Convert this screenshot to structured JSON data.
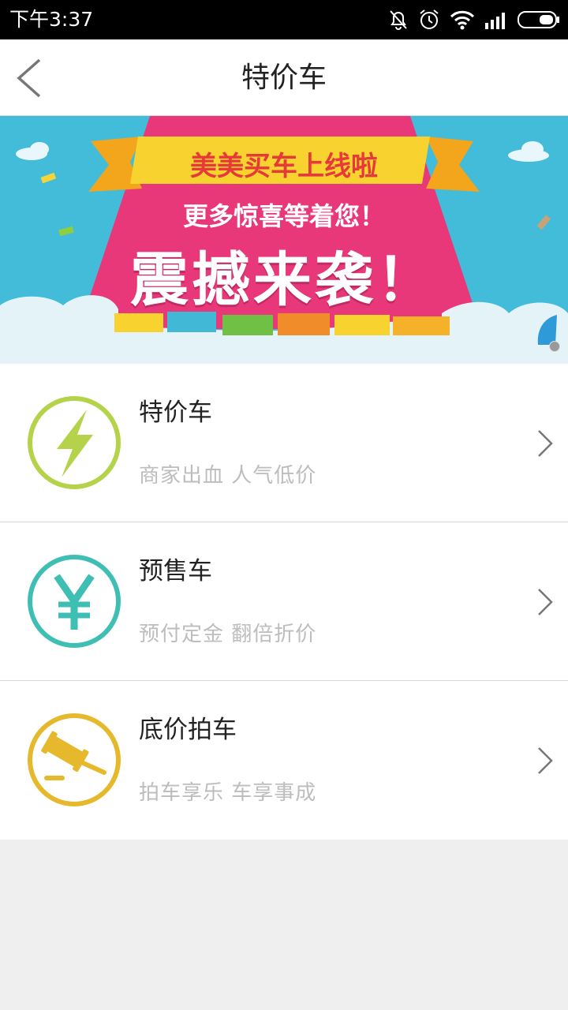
{
  "status_bar": {
    "time": "下午3:37"
  },
  "navbar": {
    "title": "特价车"
  },
  "banner": {
    "line1": "美美买车上线啦",
    "line2": "更多惊喜等着您！",
    "line3": "震撼来袭！"
  },
  "items": [
    {
      "title": "特价车",
      "subtitle": "商家出血  人气低价",
      "icon": "lightning-icon",
      "color": "#b5d34a"
    },
    {
      "title": "预售车",
      "subtitle": "预付定金  翻倍折价",
      "icon": "yen-icon",
      "color": "#3fbfb3"
    },
    {
      "title": "底价拍车",
      "subtitle": "拍车享乐  车享事成",
      "icon": "gavel-icon",
      "color": "#e5b92b"
    }
  ]
}
